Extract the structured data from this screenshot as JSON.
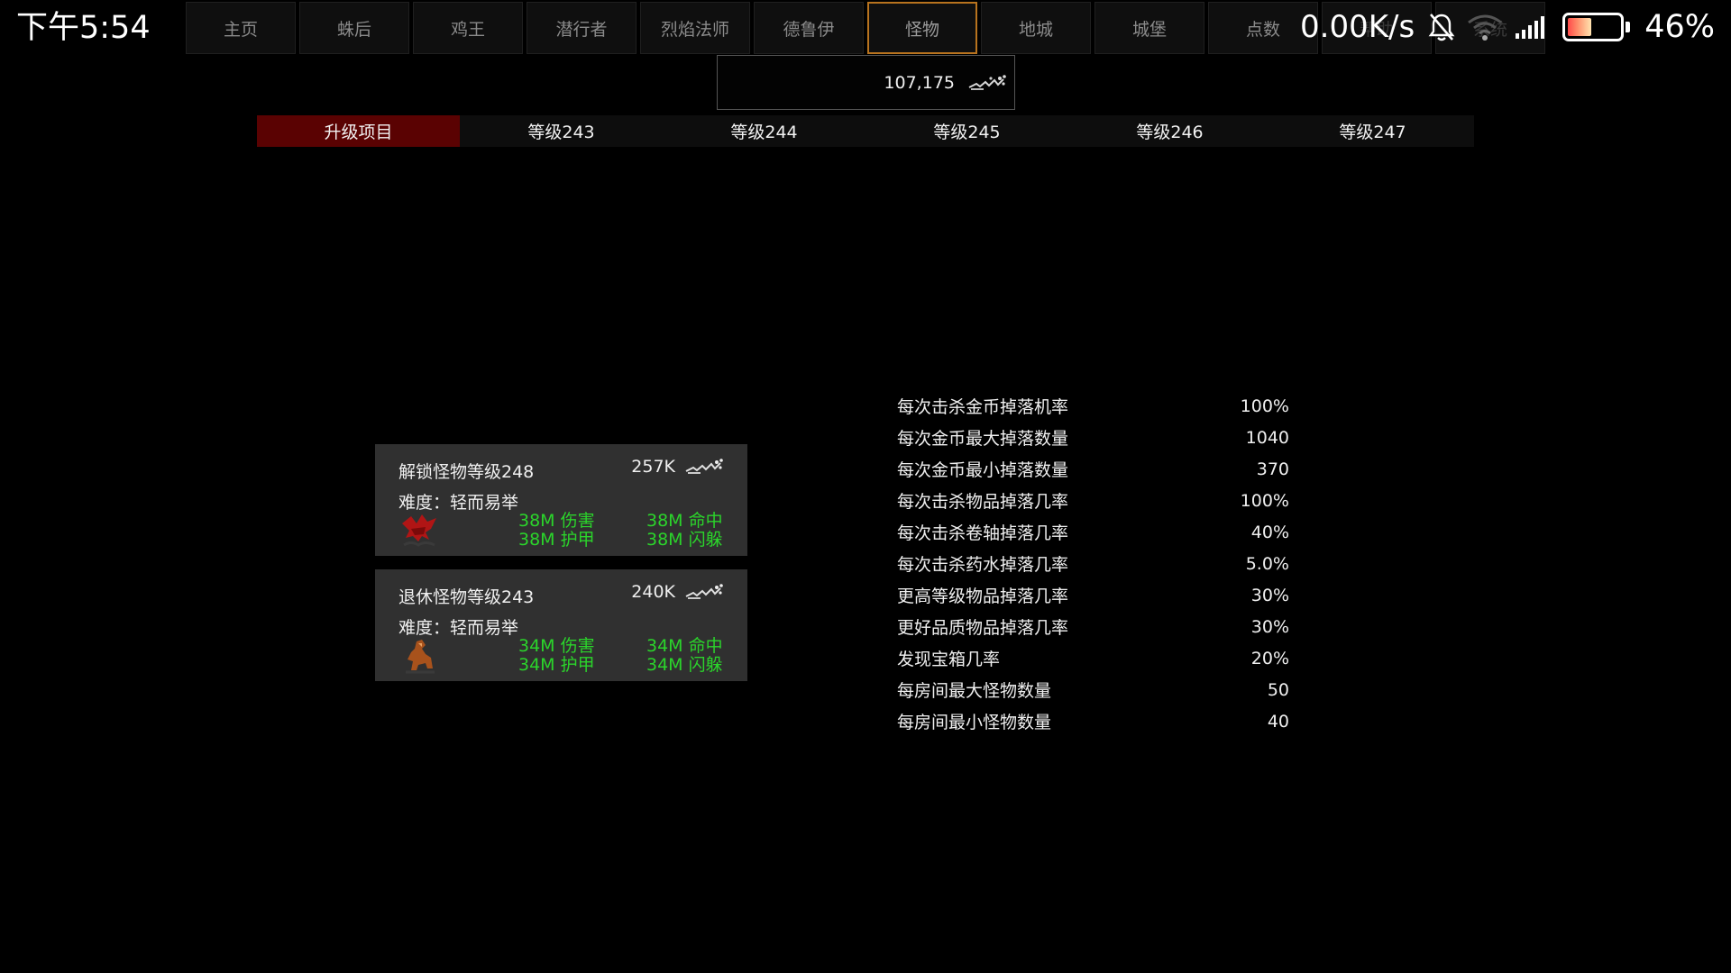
{
  "status_bar": {
    "time": "下午5:54",
    "net_speed": "0.00K/s",
    "battery_percent": "46%",
    "battery_level": 0.46
  },
  "top_nav": {
    "tabs": [
      {
        "label": "主页"
      },
      {
        "label": "蛛后"
      },
      {
        "label": "鸡王"
      },
      {
        "label": "潜行者"
      },
      {
        "label": "烈焰法师"
      },
      {
        "label": "德鲁伊"
      },
      {
        "label": "怪物"
      },
      {
        "label": "地城"
      },
      {
        "label": "城堡"
      },
      {
        "label": "点数"
      },
      {
        "label": "帮助"
      },
      {
        "label": "系统"
      }
    ],
    "active": "怪物"
  },
  "currency": {
    "amount": "107,175"
  },
  "sub_tabs": [
    {
      "label": "升级项目"
    },
    {
      "label": "等级243"
    },
    {
      "label": "等级244"
    },
    {
      "label": "等级245"
    },
    {
      "label": "等级246"
    },
    {
      "label": "等级247"
    }
  ],
  "monster_cards": [
    {
      "title": "解锁怪物等级248",
      "cost": "257K",
      "difficulty": "难度：轻而易举",
      "sprite": "red-dragon-icon",
      "damage": "38M 伤害",
      "hit": "38M 命中",
      "armor": "38M 护甲",
      "dodge": "38M 闪躲"
    },
    {
      "title": "退休怪物等级243",
      "cost": "240K",
      "difficulty": "难度：轻而易举",
      "sprite": "brown-beast-icon",
      "damage": "34M 伤害",
      "hit": "34M 命中",
      "armor": "34M 护甲",
      "dodge": "34M 闪躲"
    }
  ],
  "drop_stats": [
    {
      "label": "每次击杀金币掉落机率",
      "value": "100%"
    },
    {
      "label": "每次金币最大掉落数量",
      "value": "1040"
    },
    {
      "label": "每次金币最小掉落数量",
      "value": "370"
    },
    {
      "label": "每次击杀物品掉落几率",
      "value": "100%"
    },
    {
      "label": "每次击杀卷轴掉落几率",
      "value": "40%"
    },
    {
      "label": "每次击杀药水掉落几率",
      "value": "5.0%"
    },
    {
      "label": "更高等级物品掉落几率",
      "value": "30%"
    },
    {
      "label": "更好品质物品掉落几率",
      "value": "30%"
    },
    {
      "label": "发现宝箱几率",
      "value": "20%"
    },
    {
      "label": "每房间最大怪物数量",
      "value": "50"
    },
    {
      "label": "每房间最小怪物数量",
      "value": "40"
    }
  ],
  "colors": {
    "background": "#000000",
    "active_subtab": "#5a0202",
    "active_nav_border": "#b8731e",
    "stat_green": "#2bd42b",
    "card_bg": "#303030"
  }
}
